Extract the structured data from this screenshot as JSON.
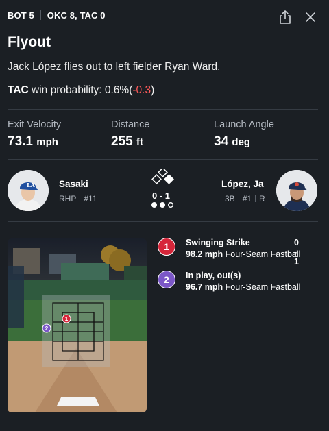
{
  "header": {
    "inning": "BOT 5",
    "score": "OKC 8, TAC 0"
  },
  "play": {
    "title": "Flyout",
    "description": "Jack López flies out to left fielder Ryan Ward.",
    "win_prob_team": "TAC",
    "win_prob_label": "win probability:",
    "win_prob_value": "0.6%",
    "win_prob_open": "(",
    "win_prob_change": "-0.3",
    "win_prob_close": ")"
  },
  "stats": [
    {
      "label": "Exit Velocity",
      "value": "73.1",
      "unit": "mph"
    },
    {
      "label": "Distance",
      "value": "255",
      "unit": "ft"
    },
    {
      "label": "Launch Angle",
      "value": "34",
      "unit": "deg"
    }
  ],
  "pitcher": {
    "name": "Sasaki",
    "hand": "RHP",
    "number": "#11",
    "cap_color": "#1f4fa0"
  },
  "batter": {
    "name": "López, Ja",
    "position": "3B",
    "order": "#1",
    "bats": "R",
    "cap_color": "#1e2f52"
  },
  "situation": {
    "count": "0 - 1",
    "bases": {
      "first": true,
      "second": false,
      "third": false
    },
    "outs": 2,
    "outs_max": 3
  },
  "pitches": [
    {
      "num": "1",
      "result": "Swinging Strike",
      "count": "0 - 1",
      "speed": "98.2 mph",
      "type": "Four-Seam Fastball",
      "color": "#d6263a"
    },
    {
      "num": "2",
      "result": "In play, out(s)",
      "count": "",
      "speed": "96.7 mph",
      "type": "Four-Seam Fastball",
      "color": "#7b57c7"
    }
  ],
  "icons": {
    "share": "share-icon",
    "close": "close-icon"
  }
}
